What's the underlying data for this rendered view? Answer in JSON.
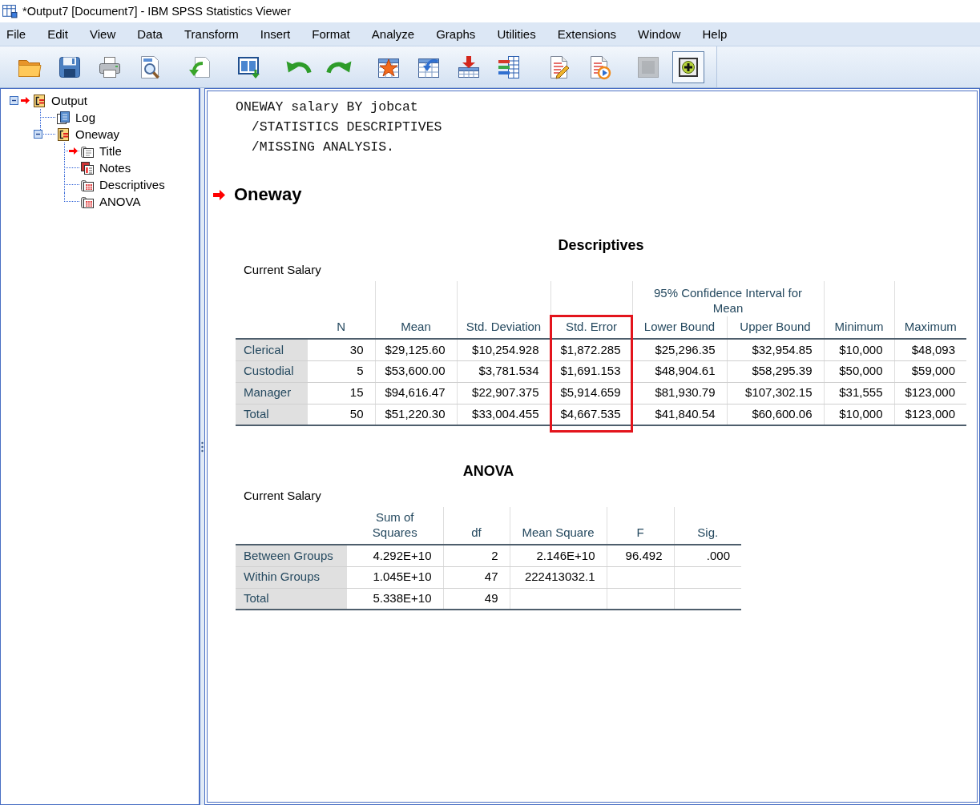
{
  "window": {
    "title": "*Output7 [Document7] - IBM SPSS Statistics Viewer"
  },
  "menu": [
    {
      "label": "File"
    },
    {
      "label": "Edit"
    },
    {
      "label": "View"
    },
    {
      "label": "Data"
    },
    {
      "label": "Transform"
    },
    {
      "label": "Insert"
    },
    {
      "label": "Format"
    },
    {
      "label": "Analyze"
    },
    {
      "label": "Graphs"
    },
    {
      "label": "Utilities"
    },
    {
      "label": "Extensions"
    },
    {
      "label": "Window"
    },
    {
      "label": "Help"
    }
  ],
  "toolbar": [
    [
      {
        "kind": "folder",
        "disabled": false,
        "pressed": false
      },
      {
        "kind": "floppy",
        "disabled": false,
        "pressed": false
      },
      {
        "kind": "printer",
        "disabled": false,
        "pressed": false
      },
      {
        "kind": "preview",
        "disabled": false,
        "pressed": false
      }
    ],
    [
      {
        "kind": "export",
        "disabled": false,
        "pressed": false
      }
    ],
    [
      {
        "kind": "panes",
        "disabled": false,
        "pressed": false
      }
    ],
    [
      {
        "kind": "undo",
        "disabled": false,
        "pressed": false
      },
      {
        "kind": "redo",
        "disabled": false,
        "pressed": false
      }
    ],
    [
      {
        "kind": "star-grid",
        "disabled": false,
        "pressed": false
      },
      {
        "kind": "goto-grid",
        "disabled": false,
        "pressed": false
      },
      {
        "kind": "down-grid",
        "disabled": false,
        "pressed": false
      },
      {
        "kind": "bars-grid",
        "disabled": false,
        "pressed": false
      }
    ],
    [
      {
        "kind": "pencil-page",
        "disabled": false,
        "pressed": false
      },
      {
        "kind": "play-page",
        "disabled": false,
        "pressed": false
      }
    ],
    [
      {
        "kind": "square",
        "disabled": true,
        "pressed": false
      },
      {
        "kind": "plus-circle",
        "disabled": false,
        "pressed": true
      }
    ]
  ],
  "outline": [
    {
      "label": "Output",
      "kind": "heading",
      "expanded": true,
      "current": true,
      "children": [
        {
          "label": "Log",
          "kind": "log",
          "current": false
        },
        {
          "label": "Oneway",
          "kind": "heading",
          "expanded": true,
          "current": false,
          "children": [
            {
              "label": "Title",
              "kind": "title",
              "current": true
            },
            {
              "label": "Notes",
              "kind": "notes",
              "current": false
            },
            {
              "label": "Descriptives",
              "kind": "table",
              "current": false
            },
            {
              "label": "ANOVA",
              "kind": "table",
              "current": false
            }
          ]
        }
      ]
    }
  ],
  "viewer": {
    "syntax": {
      "command": "ONEWAY salary BY jobcat",
      "subcommands": [
        "/STATISTICS DESCRIPTIVES",
        "/MISSING ANALYSIS."
      ]
    },
    "heading": {
      "text": "Oneway",
      "current": true
    },
    "tables": [
      {
        "title": "Descriptives",
        "caption": "Current Salary",
        "columns": [
          {
            "label": "N",
            "highlighted": false
          },
          {
            "label": "Mean",
            "highlighted": false
          },
          {
            "label": "Std. Deviation",
            "highlighted": false
          },
          {
            "label": "Std. Error",
            "highlighted": true
          },
          {
            "label": "95% Confidence Interval for Mean",
            "colspan": 2,
            "highlighted": false,
            "children": [
              {
                "label": "Lower Bound",
                "highlighted": false
              },
              {
                "label": "Upper Bound",
                "highlighted": false
              }
            ]
          },
          {
            "label": "Minimum",
            "highlighted": false
          },
          {
            "label": "Maximum",
            "highlighted": false
          }
        ],
        "rows": [
          {
            "label": "Clerical",
            "cells": [
              "30",
              "$29,125.60",
              "$10,254.928",
              "$1,872.285",
              "$25,296.35",
              "$32,954.85",
              "$10,000",
              "$48,093"
            ]
          },
          {
            "label": "Custodial",
            "cells": [
              "5",
              "$53,600.00",
              "$3,781.534",
              "$1,691.153",
              "$48,904.61",
              "$58,295.39",
              "$50,000",
              "$59,000"
            ]
          },
          {
            "label": "Manager",
            "cells": [
              "15",
              "$94,616.47",
              "$22,907.375",
              "$5,914.659",
              "$81,930.79",
              "$107,302.15",
              "$31,555",
              "$123,000"
            ]
          },
          {
            "label": "Total",
            "cells": [
              "50",
              "$51,220.30",
              "$33,004.455",
              "$4,667.535",
              "$41,840.54",
              "$60,600.06",
              "$10,000",
              "$123,000"
            ]
          }
        ]
      },
      {
        "title": "ANOVA",
        "caption": "Current Salary",
        "columns": [
          {
            "label": "Sum of Squares"
          },
          {
            "label": "df"
          },
          {
            "label": "Mean Square"
          },
          {
            "label": "F"
          },
          {
            "label": "Sig."
          }
        ],
        "rows": [
          {
            "label": "Between Groups",
            "cells": [
              "4.292E+10",
              "2",
              "2.146E+10",
              "96.492",
              ".000"
            ]
          },
          {
            "label": "Within Groups",
            "cells": [
              "1.045E+10",
              "47",
              "222413032.1"
            ]
          },
          {
            "label": "Total",
            "cells": [
              "5.338E+10",
              "49"
            ]
          }
        ]
      }
    ]
  }
}
